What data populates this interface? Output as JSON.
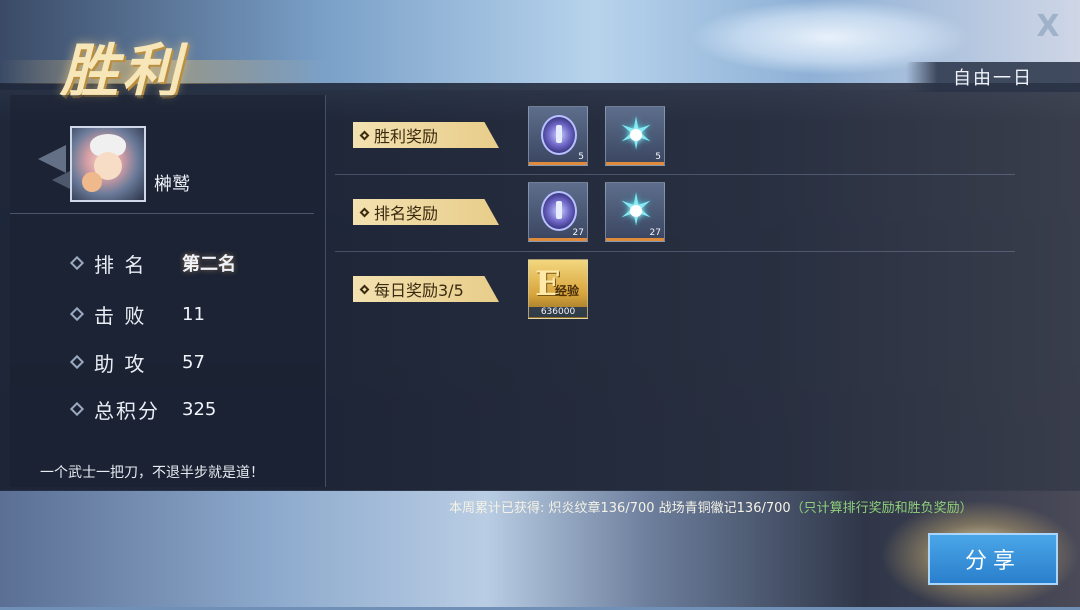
{
  "header": {
    "title": "胜利",
    "mode": "自由一日",
    "close_label": "X"
  },
  "player": {
    "name": "榊鹫"
  },
  "stats": [
    {
      "label": "排 名",
      "value": "第二名"
    },
    {
      "label": "击 败",
      "value": "11"
    },
    {
      "label": "助 攻",
      "value": "57"
    },
    {
      "label": "总积分",
      "value": "325"
    }
  ],
  "motto": "一个武士一把刀，不退半步就是道！",
  "rewards": {
    "victory": {
      "label": "胜利奖励",
      "items": [
        {
          "icon": "badge-emblem-icon",
          "count": "5"
        },
        {
          "icon": "bronze-star-emblem-icon",
          "count": "5"
        }
      ]
    },
    "rank": {
      "label": "排名奖励",
      "items": [
        {
          "icon": "badge-emblem-icon",
          "count": "27"
        },
        {
          "icon": "bronze-star-emblem-icon",
          "count": "27"
        }
      ]
    },
    "daily": {
      "label": "每日奖励3/5",
      "items": [
        {
          "icon": "exp-icon",
          "letter": "E",
          "word": "经验",
          "count": "636000"
        }
      ]
    }
  },
  "weekly": {
    "text": "本周累计已获得: 炽炎纹章136/700 战场青铜徽记136/700",
    "note": "（只计算排行奖励和胜负奖励）"
  },
  "share_label": "分享",
  "colors": {
    "accent_gold": "#f3d9a2",
    "share_blue": "#2a7fcc",
    "note_green": "#8fd07a",
    "count_bar_orange": "#e08a3c"
  }
}
